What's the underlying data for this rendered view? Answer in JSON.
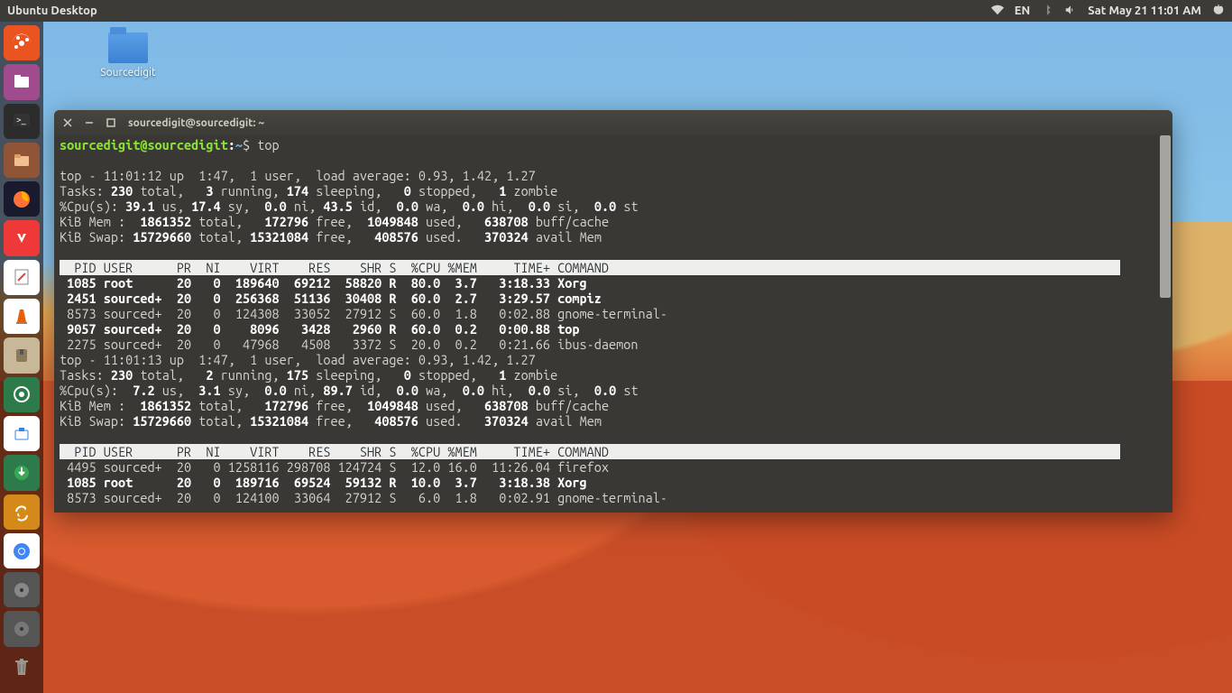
{
  "topbar": {
    "title": "Ubuntu Desktop",
    "lang": "EN",
    "clock": "Sat May 21 11:01 AM"
  },
  "desktop_folder": "Sourcedigit",
  "terminal": {
    "title": "sourcedigit@sourcedigit: ~",
    "prompt_user": "sourcedigit@sourcedigit",
    "prompt_path": "~",
    "prompt_cmd": "top"
  },
  "top1": {
    "summary": "top - 11:01:12 up  1:47,  1 user,  load average: 0.93, 1.42, 1.27",
    "tasks_total": "230",
    "tasks_running": "3",
    "tasks_sleeping": "174",
    "tasks_stopped": "0",
    "tasks_zombie": "1",
    "cpu_us": "39.1",
    "cpu_sy": "17.4",
    "cpu_ni": "0.0",
    "cpu_id": "43.5",
    "cpu_wa": "0.0",
    "cpu_hi": "0.0",
    "cpu_si": "0.0",
    "cpu_st": "0.0",
    "mem_total": "1861352",
    "mem_free": "172796",
    "mem_used": "1049848",
    "mem_buff": "638708",
    "swap_total": "15729660",
    "swap_free": "15321084",
    "swap_used": "408576",
    "swap_avail": "370324",
    "header": "  PID USER      PR  NI    VIRT    RES    SHR S  %CPU %MEM     TIME+ COMMAND",
    "rows": [
      {
        "pid": "1085",
        "user": "root",
        "pr": "20",
        "ni": "0",
        "virt": "189640",
        "res": "69212",
        "shr": "58820",
        "s": "R",
        "cpu": "80.0",
        "mem": "3.7",
        "time": "3:18.33",
        "cmd": "Xorg",
        "bold": true
      },
      {
        "pid": "2451",
        "user": "sourced+",
        "pr": "20",
        "ni": "0",
        "virt": "256368",
        "res": "51136",
        "shr": "30408",
        "s": "R",
        "cpu": "60.0",
        "mem": "2.7",
        "time": "3:29.57",
        "cmd": "compiz",
        "bold": true
      },
      {
        "pid": "8573",
        "user": "sourced+",
        "pr": "20",
        "ni": "0",
        "virt": "124308",
        "res": "33052",
        "shr": "27912",
        "s": "S",
        "cpu": "60.0",
        "mem": "1.8",
        "time": "0:02.88",
        "cmd": "gnome-terminal-",
        "bold": false
      },
      {
        "pid": "9057",
        "user": "sourced+",
        "pr": "20",
        "ni": "0",
        "virt": "8096",
        "res": "3428",
        "shr": "2960",
        "s": "R",
        "cpu": "60.0",
        "mem": "0.2",
        "time": "0:00.88",
        "cmd": "top",
        "bold": true
      },
      {
        "pid": "2275",
        "user": "sourced+",
        "pr": "20",
        "ni": "0",
        "virt": "47968",
        "res": "4508",
        "shr": "3372",
        "s": "S",
        "cpu": "20.0",
        "mem": "0.2",
        "time": "0:21.66",
        "cmd": "ibus-daemon",
        "bold": false
      }
    ]
  },
  "top2": {
    "summary": "top - 11:01:13 up  1:47,  1 user,  load average: 0.93, 1.42, 1.27",
    "tasks_total": "230",
    "tasks_running": "2",
    "tasks_sleeping": "175",
    "tasks_stopped": "0",
    "tasks_zombie": "1",
    "cpu_us": "7.2",
    "cpu_sy": "3.1",
    "cpu_ni": "0.0",
    "cpu_id": "89.7",
    "cpu_wa": "0.0",
    "cpu_hi": "0.0",
    "cpu_si": "0.0",
    "cpu_st": "0.0",
    "mem_total": "1861352",
    "mem_free": "172796",
    "mem_used": "1049848",
    "mem_buff": "638708",
    "swap_total": "15729660",
    "swap_free": "15321084",
    "swap_used": "408576",
    "swap_avail": "370324",
    "header": "  PID USER      PR  NI    VIRT    RES    SHR S  %CPU %MEM     TIME+ COMMAND",
    "rows": [
      {
        "pid": "4495",
        "user": "sourced+",
        "pr": "20",
        "ni": "0",
        "virt": "1258116",
        "res": "298708",
        "shr": "124724",
        "s": "S",
        "cpu": "12.0",
        "mem": "16.0",
        "time": "11:26.04",
        "cmd": "firefox",
        "bold": false
      },
      {
        "pid": "1085",
        "user": "root",
        "pr": "20",
        "ni": "0",
        "virt": "189716",
        "res": "69524",
        "shr": "59132",
        "s": "R",
        "cpu": "10.0",
        "mem": "3.7",
        "time": "3:18.38",
        "cmd": "Xorg",
        "bold": true
      },
      {
        "pid": "8573",
        "user": "sourced+",
        "pr": "20",
        "ni": "0",
        "virt": "124100",
        "res": "33064",
        "shr": "27912",
        "s": "S",
        "cpu": "6.0",
        "mem": "1.8",
        "time": "0:02.91",
        "cmd": "gnome-terminal-",
        "bold": false
      }
    ]
  }
}
